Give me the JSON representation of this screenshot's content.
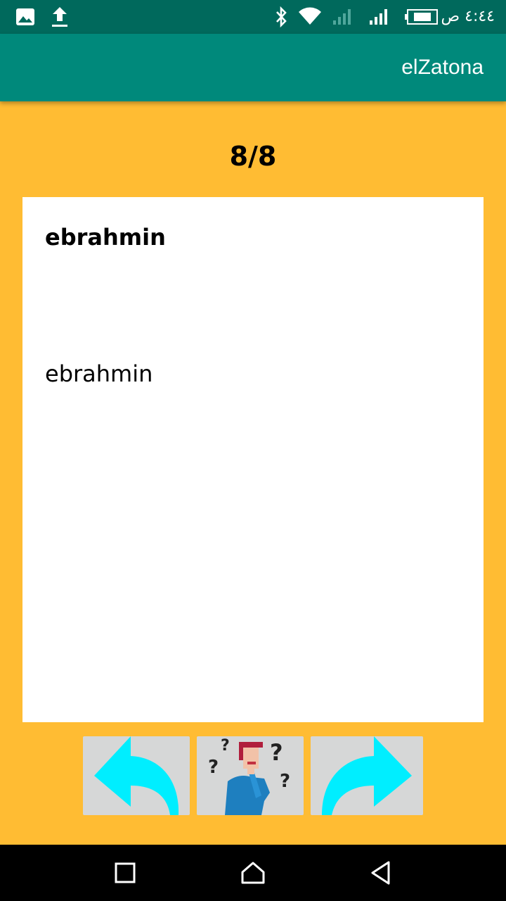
{
  "status_bar": {
    "time": "٤:٤٤ ص",
    "icons": [
      "image-icon",
      "upload-icon",
      "bluetooth-icon",
      "wifi-icon",
      "signal-weak-icon",
      "signal-icon",
      "battery-icon"
    ]
  },
  "app_bar": {
    "title": "elZatona"
  },
  "quiz": {
    "counter": "8/8",
    "question": "ebrahmin",
    "answer": "ebrahmin"
  },
  "controls": {
    "icons": [
      "back-arrow-icon",
      "thinking-person-icon",
      "forward-arrow-icon"
    ]
  },
  "nav": {
    "icons": [
      "recents-icon",
      "home-icon",
      "back-icon"
    ]
  },
  "colors": {
    "background": "#FFBC33",
    "status_bar": "#00695C",
    "app_bar": "#00897B",
    "arrow": "#00EEFF",
    "button_bg": "#D6D7D7"
  }
}
